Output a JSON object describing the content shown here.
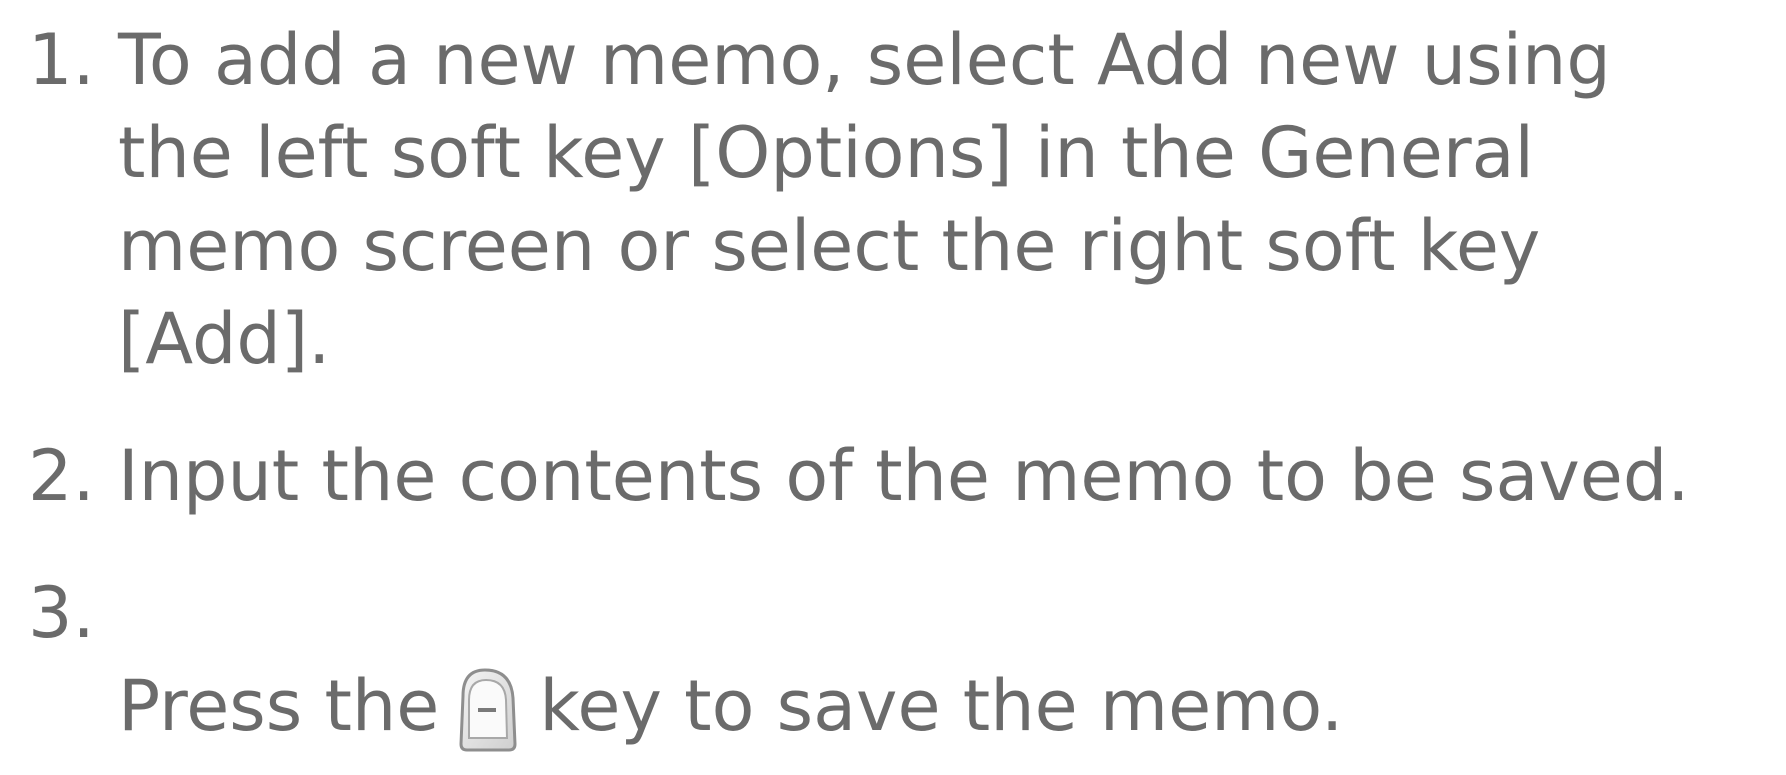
{
  "steps": [
    {
      "number": "1.",
      "text": "To add a new memo, select Add new using\nthe left soft key [Options] in the General\nmemo screen or select the right soft key\n[Add]."
    },
    {
      "number": "2.",
      "text": "Input the contents of the memo to be saved."
    },
    {
      "number": "3.",
      "text_before": "Press the",
      "key_icon": "left-soft-key-icon",
      "text_after": "key to save the memo."
    }
  ]
}
